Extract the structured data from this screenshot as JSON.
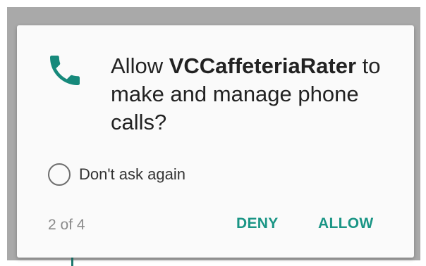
{
  "dialog": {
    "title_prefix": "Allow ",
    "app_name": "VCCaffeteriaRater",
    "title_suffix": " to make and manage phone calls?",
    "checkbox_label": "Don't ask again",
    "counter": "2 of 4",
    "deny_label": "DENY",
    "allow_label": "ALLOW",
    "icon": "phone-icon"
  },
  "colors": {
    "accent": "#1a9585",
    "icon": "#16897b",
    "backdrop": "#a9a9a9",
    "surface": "#fafafa"
  }
}
